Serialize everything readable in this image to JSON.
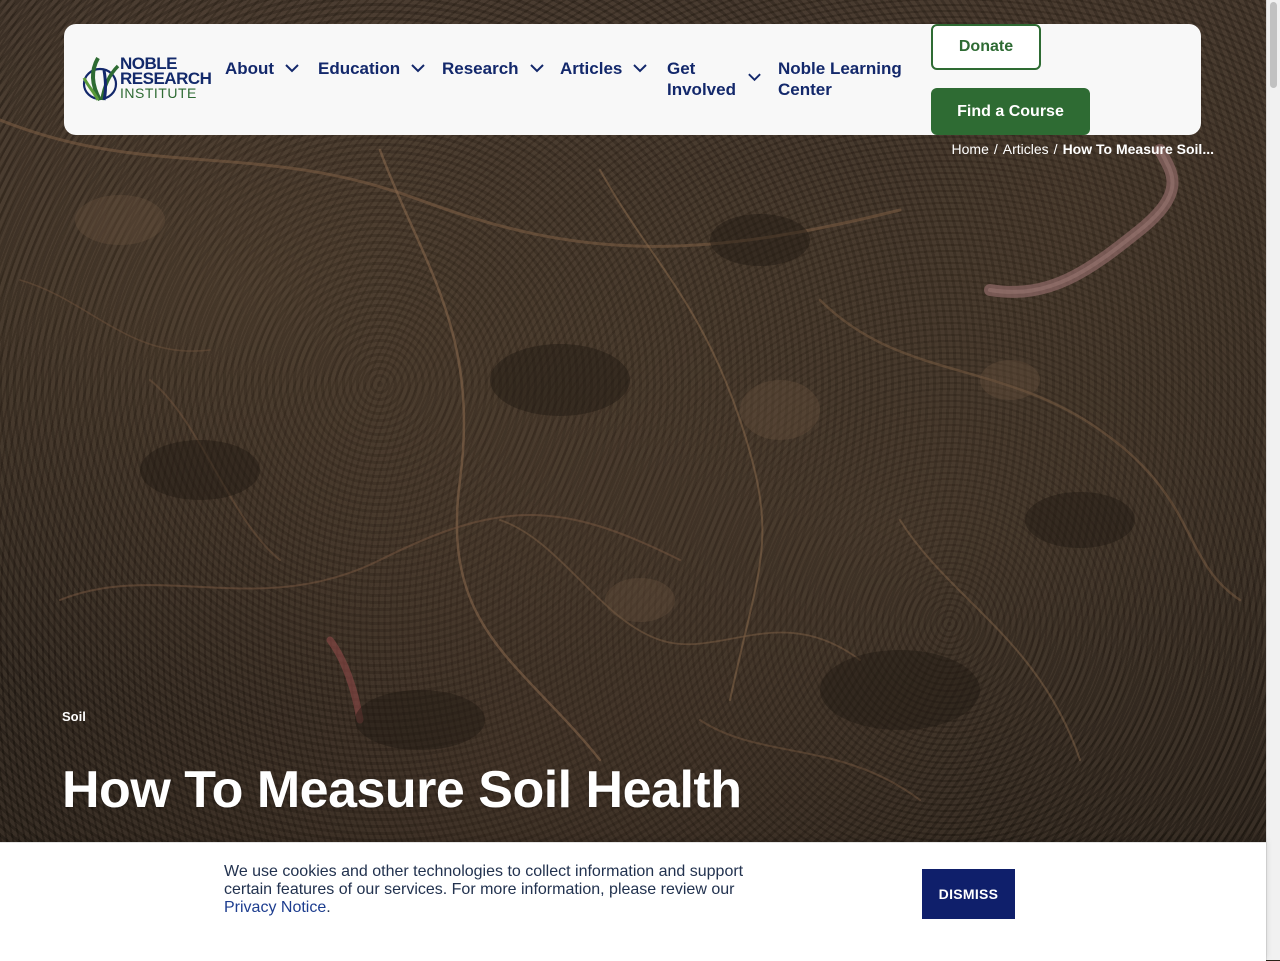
{
  "logo": {
    "line1": "NOBLE",
    "line2": "RESEARCH",
    "line3": "INSTITUTE"
  },
  "nav": {
    "items": [
      {
        "label": "About"
      },
      {
        "label": "Education"
      },
      {
        "label": "Research"
      },
      {
        "label": "Articles"
      },
      {
        "label": "Get Involved"
      }
    ],
    "noble_learning": "Noble Learning Center",
    "donate_label": "Donate",
    "course_label": "Find a Course"
  },
  "breadcrumb": {
    "home": "Home",
    "articles": "Articles",
    "current": "How To Measure Soil..."
  },
  "hero": {
    "tag": "Soil",
    "title": "How To Measure Soil Health"
  },
  "cookie": {
    "message": "We use cookies and other technologies to collect information and support certain features of our services. For more information, please review our",
    "link": "Privacy Notice",
    "trailing": ".",
    "dismiss_label": "DISMISS"
  },
  "colors": {
    "brand_navy": "#13286b",
    "brand_green": "#2e6b33",
    "dismiss_bg": "#0f1f6b"
  }
}
